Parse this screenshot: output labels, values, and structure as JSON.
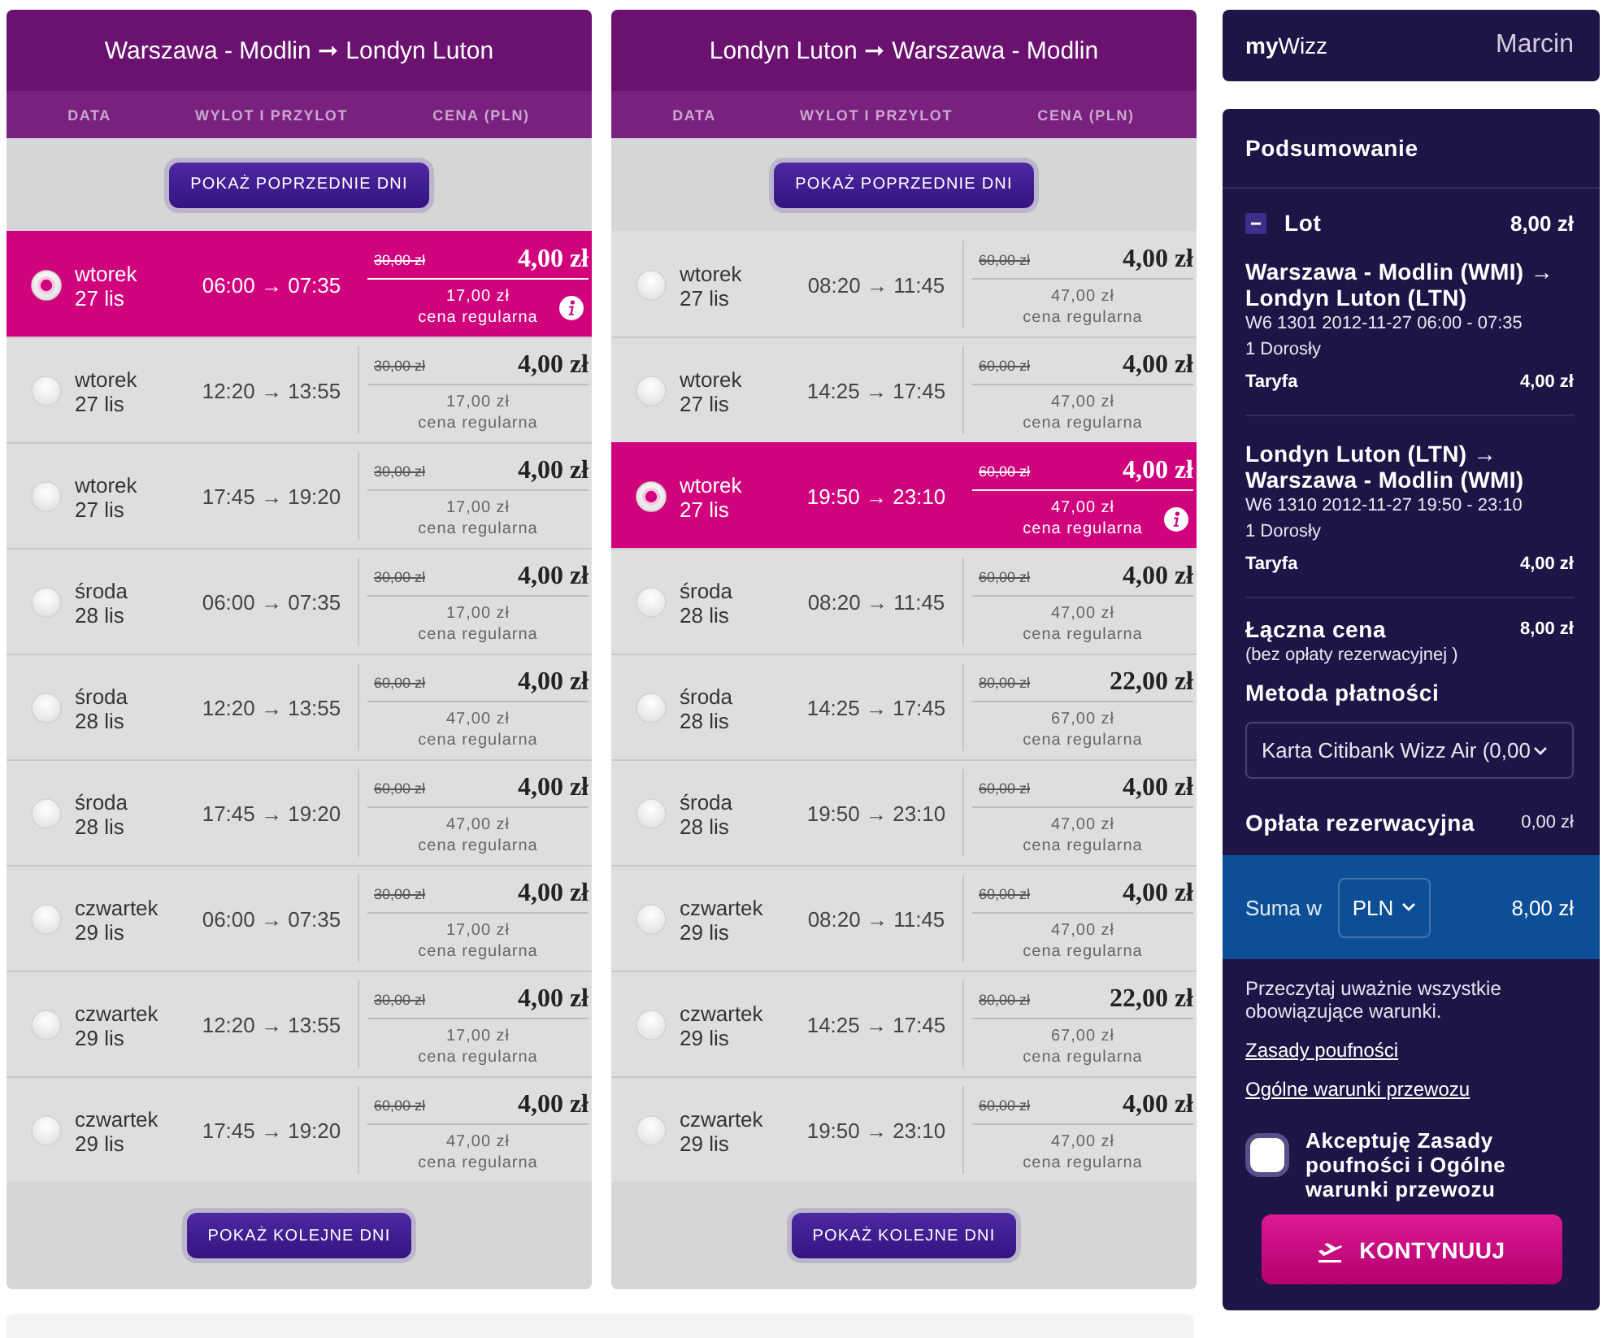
{
  "flights": [
    {
      "title": "Warszawa - Modlin ➞ Londyn Luton",
      "columns": [
        "DATA",
        "WYLOT I PRZYLOT",
        "CENA (PLN)"
      ],
      "show_previous": "POKAŻ POPRZEDNIE DNI",
      "rows": [
        {
          "selected": true,
          "day": "wtorek",
          "date": "27 lis",
          "times": "06:00 → 07:35",
          "old_price": "30,00 zł",
          "price": "4,00 zł",
          "regular_price": "17,00 zł",
          "regular_label": "cena regularna"
        },
        {
          "selected": false,
          "day": "wtorek",
          "date": "27 lis",
          "times": "12:20 → 13:55",
          "old_price": "30,00 zł",
          "price": "4,00 zł",
          "regular_price": "17,00 zł",
          "regular_label": "cena regularna"
        },
        {
          "selected": false,
          "day": "wtorek",
          "date": "27 lis",
          "times": "17:45 → 19:20",
          "old_price": "30,00 zł",
          "price": "4,00 zł",
          "regular_price": "17,00 zł",
          "regular_label": "cena regularna"
        },
        {
          "selected": false,
          "day": "środa",
          "date": "28 lis",
          "times": "06:00 → 07:35",
          "old_price": "30,00 zł",
          "price": "4,00 zł",
          "regular_price": "17,00 zł",
          "regular_label": "cena regularna"
        },
        {
          "selected": false,
          "day": "środa",
          "date": "28 lis",
          "times": "12:20 → 13:55",
          "old_price": "60,00 zł",
          "price": "4,00 zł",
          "regular_price": "47,00 zł",
          "regular_label": "cena regularna"
        },
        {
          "selected": false,
          "day": "środa",
          "date": "28 lis",
          "times": "17:45 → 19:20",
          "old_price": "60,00 zł",
          "price": "4,00 zł",
          "regular_price": "47,00 zł",
          "regular_label": "cena regularna"
        },
        {
          "selected": false,
          "day": "czwartek",
          "date": "29 lis",
          "times": "06:00 → 07:35",
          "old_price": "30,00 zł",
          "price": "4,00 zł",
          "regular_price": "17,00 zł",
          "regular_label": "cena regularna"
        },
        {
          "selected": false,
          "day": "czwartek",
          "date": "29 lis",
          "times": "12:20 → 13:55",
          "old_price": "30,00 zł",
          "price": "4,00 zł",
          "regular_price": "17,00 zł",
          "regular_label": "cena regularna"
        },
        {
          "selected": false,
          "day": "czwartek",
          "date": "29 lis",
          "times": "17:45 → 19:20",
          "old_price": "60,00 zł",
          "price": "4,00 zł",
          "regular_price": "47,00 zł",
          "regular_label": "cena regularna"
        }
      ],
      "show_next": "POKAŻ KOLEJNE DNI"
    },
    {
      "title": "Londyn Luton ➞ Warszawa - Modlin",
      "columns": [
        "DATA",
        "WYLOT I PRZYLOT",
        "CENA (PLN)"
      ],
      "show_previous": "POKAŻ POPRZEDNIE DNI",
      "rows": [
        {
          "selected": false,
          "day": "wtorek",
          "date": "27 lis",
          "times": "08:20 → 11:45",
          "old_price": "60,00 zł",
          "price": "4,00 zł",
          "regular_price": "47,00 zł",
          "regular_label": "cena regularna"
        },
        {
          "selected": false,
          "day": "wtorek",
          "date": "27 lis",
          "times": "14:25 → 17:45",
          "old_price": "60,00 zł",
          "price": "4,00 zł",
          "regular_price": "47,00 zł",
          "regular_label": "cena regularna"
        },
        {
          "selected": true,
          "day": "wtorek",
          "date": "27 lis",
          "times": "19:50 → 23:10",
          "old_price": "60,00 zł",
          "price": "4,00 zł",
          "regular_price": "47,00 zł",
          "regular_label": "cena regularna"
        },
        {
          "selected": false,
          "day": "środa",
          "date": "28 lis",
          "times": "08:20 → 11:45",
          "old_price": "60,00 zł",
          "price": "4,00 zł",
          "regular_price": "47,00 zł",
          "regular_label": "cena regularna"
        },
        {
          "selected": false,
          "day": "środa",
          "date": "28 lis",
          "times": "14:25 → 17:45",
          "old_price": "80,00 zł",
          "price": "22,00 zł",
          "regular_price": "67,00 zł",
          "regular_label": "cena regularna"
        },
        {
          "selected": false,
          "day": "środa",
          "date": "28 lis",
          "times": "19:50 → 23:10",
          "old_price": "60,00 zł",
          "price": "4,00 zł",
          "regular_price": "47,00 zł",
          "regular_label": "cena regularna"
        },
        {
          "selected": false,
          "day": "czwartek",
          "date": "29 lis",
          "times": "08:20 → 11:45",
          "old_price": "60,00 zł",
          "price": "4,00 zł",
          "regular_price": "47,00 zł",
          "regular_label": "cena regularna"
        },
        {
          "selected": false,
          "day": "czwartek",
          "date": "29 lis",
          "times": "14:25 → 17:45",
          "old_price": "80,00 zł",
          "price": "22,00 zł",
          "regular_price": "67,00 zł",
          "regular_label": "cena regularna"
        },
        {
          "selected": false,
          "day": "czwartek",
          "date": "29 lis",
          "times": "19:50 → 23:10",
          "old_price": "60,00 zł",
          "price": "4,00 zł",
          "regular_price": "47,00 zł",
          "regular_label": "cena regularna"
        }
      ],
      "show_next": "POKAŻ KOLEJNE DNI"
    }
  ],
  "account": {
    "brand": "**my**Wizz",
    "user": "Marcin"
  },
  "summary": {
    "title": "Podsumowanie",
    "section": {
      "label": "Lot",
      "total": "8,00 zł",
      "expanded": true
    },
    "legs": [
      {
        "route": "Warszawa - Modlin (WMI) → Londyn Luton (LTN)",
        "flight": "W6 1301 2012-11-27 06:00 - 07:35",
        "passengers": "1 Dorosły",
        "fare_label": "Taryfa",
        "fare": "4,00 zł"
      },
      {
        "route": "Londyn Luton (LTN) → Warszawa - Modlin (WMI)",
        "flight": "W6 1310 2012-11-27 19:50 - 23:10",
        "passengers": "1 Dorosły",
        "fare_label": "Taryfa",
        "fare": "4,00 zł"
      }
    ],
    "total": {
      "label": "Łączna cena",
      "value": "8,00 zł",
      "note": "(bez opłaty rezerwacyjnej )"
    },
    "payment": {
      "label": "Metoda płatności",
      "value": "Karta Citibank Wizz Air (0,00"
    },
    "booking_fee": {
      "label": "Opłata rezerwacyjna",
      "value": "0,00 zł"
    },
    "sum": {
      "label": "Suma w",
      "currency": "PLN",
      "value": "8,00 zł"
    },
    "terms": {
      "text": "Przeczytaj uważnie wszystkie obowiązujące warunki.",
      "links": [
        "Zasady poufności",
        "Ogólne warunki przewozu"
      ],
      "accept": {
        "label": "Akceptuję Zasady poufności i Ogólne warunki przewozu",
        "checked": false
      }
    },
    "continue": "KONTYNUUJ"
  }
}
